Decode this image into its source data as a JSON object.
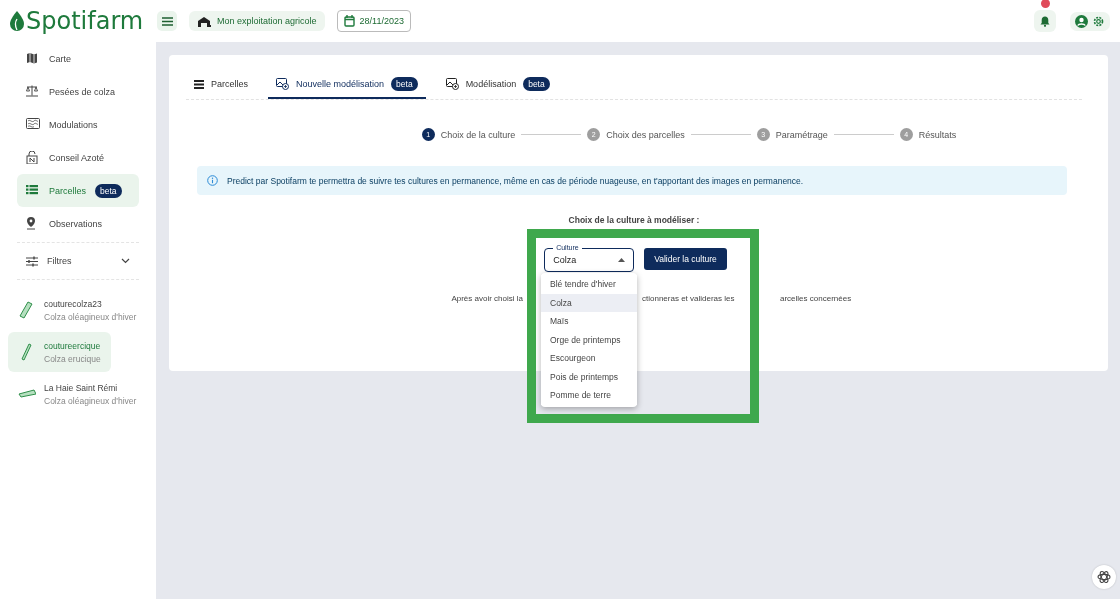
{
  "header": {
    "logo": "Spotifarm",
    "farm": "Mon exploitation agricole",
    "date": "28/11/2023",
    "has_notification": true
  },
  "sidebar": {
    "items": [
      {
        "kind": "map",
        "label": "Carte",
        "selected": false
      },
      {
        "kind": "scale",
        "label": "Pesées de colza",
        "selected": false
      },
      {
        "kind": "modulation",
        "label": "Modulations",
        "selected": false
      },
      {
        "kind": "nitrogen",
        "label": "Conseil Azoté",
        "selected": false
      },
      {
        "kind": "parcels",
        "label": "Parcelles",
        "badge": "beta",
        "selected": true
      },
      {
        "kind": "pin",
        "label": "Observations",
        "selected": false
      }
    ],
    "filter": {
      "label": "Filtres",
      "expanded": false
    },
    "fields": [
      {
        "kind": "strip",
        "name": "couturecolza23",
        "crop": "Colza oléagineux d'hiver",
        "selected": false
      },
      {
        "kind": "thin",
        "name": "coutureercique",
        "crop": "Colza erucique",
        "selected": true
      },
      {
        "kind": "flat",
        "name": "La Haie Saint Rémi",
        "crop": "Colza oléagineux d'hiver",
        "selected": false
      }
    ]
  },
  "tabs": [
    {
      "kind": "list",
      "label": "Parcelles",
      "selected": false
    },
    {
      "kind": "image",
      "label": "Nouvelle modélisation",
      "badge": "beta",
      "selected": true
    },
    {
      "kind": "image",
      "label": "Modélisation",
      "badge": "beta",
      "selected": false
    }
  ],
  "steps": [
    {
      "number": "1",
      "label": "Choix de la culture",
      "active": true
    },
    {
      "number": "2",
      "label": "Choix des parcelles",
      "active": false
    },
    {
      "number": "3",
      "label": "Paramétrage",
      "active": false
    },
    {
      "number": "4",
      "label": "Résultats",
      "active": false
    }
  ],
  "info": "Predict par Spotifarm te permettra de suivre tes cultures en permanence, même en cas de période nuageuse, en t'apportant des images en permanence.",
  "prompt": "Choix de la culture à modéliser :",
  "select": {
    "label": "Culture",
    "value": "Colza",
    "expanded": true
  },
  "validate_button": "Valider la culture",
  "hint_fragments": [
    "Après avoir choisi la",
    "ctionneras et valideras les",
    "arcelles concernées"
  ],
  "options": [
    {
      "label": "Blé tendre d'hiver",
      "selected": false
    },
    {
      "label": "Colza",
      "selected": true
    },
    {
      "label": "Maïs",
      "selected": false
    },
    {
      "label": "Orge de printemps",
      "selected": false
    },
    {
      "label": "Escourgeon",
      "selected": false
    },
    {
      "label": "Pois de printemps",
      "selected": false
    },
    {
      "label": "Pomme de terre",
      "selected": false
    }
  ]
}
